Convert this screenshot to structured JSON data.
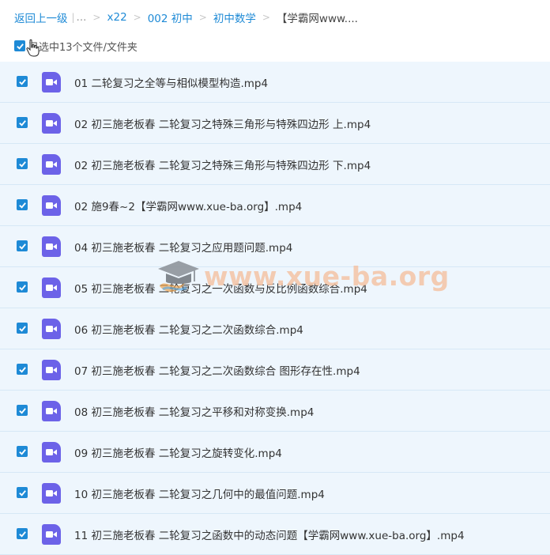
{
  "breadcrumb": {
    "back": "返回上一级",
    "ellipsis": "...",
    "items": [
      "x22",
      "002 初中",
      "初中数学"
    ],
    "current": "【学霸网www...."
  },
  "selection": {
    "label": "已选中13个文件/文件夹"
  },
  "files": [
    {
      "name": "01 二轮复习之全等与相似模型构造.mp4"
    },
    {
      "name": "02 初三施老板春 二轮复习之特殊三角形与特殊四边形 上.mp4"
    },
    {
      "name": "02 初三施老板春 二轮复习之特殊三角形与特殊四边形 下.mp4"
    },
    {
      "name": "02 施9春~2【学霸网www.xue-ba.org】.mp4"
    },
    {
      "name": "04 初三施老板春 二轮复习之应用题问题.mp4"
    },
    {
      "name": "05 初三施老板春 二轮复习之一次函数与反比例函数综合.mp4"
    },
    {
      "name": "06 初三施老板春 二轮复习之二次函数综合.mp4"
    },
    {
      "name": "07 初三施老板春 二轮复习之二次函数综合 图形存在性.mp4"
    },
    {
      "name": "08 初三施老板春 二轮复习之平移和对称变换.mp4"
    },
    {
      "name": "09 初三施老板春 二轮复习之旋转变化.mp4"
    },
    {
      "name": "10 初三施老板春 二轮复习之几何中的最值问题.mp4"
    },
    {
      "name": "11 初三施老板春 二轮复习之函数中的动态问题【学霸网www.xue-ba.org】.mp4"
    }
  ],
  "watermark": {
    "text": "www.xue-ba.org"
  },
  "colors": {
    "accent": "#1e8ad6",
    "video_icon": "#6c62e8",
    "row_bg": "#eef6fd"
  }
}
